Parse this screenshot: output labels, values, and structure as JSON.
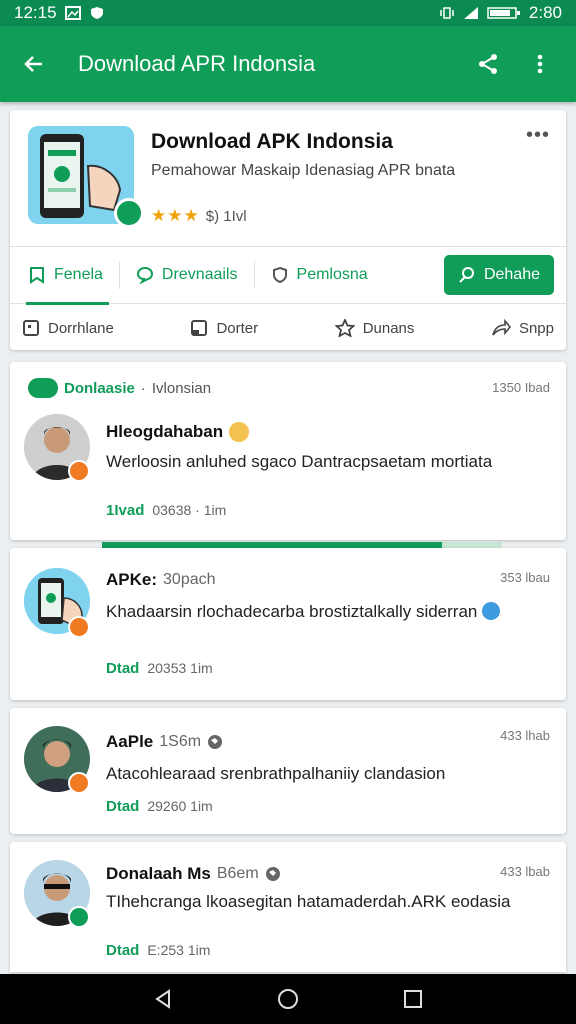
{
  "status_bar": {
    "time": "12:15",
    "right_text": "2:80"
  },
  "app_bar": {
    "title": "Download APR Indonsia"
  },
  "app_card": {
    "name": "Download APK Indonsia",
    "description": "Pemahowar Maskaip Idenasiag APR bnata",
    "rating_text": "$) 1Ivl",
    "stars": 3
  },
  "tabs": [
    {
      "label": "Fenela",
      "icon": "bookmark-icon"
    },
    {
      "label": "Drevnaails",
      "icon": "chat-icon"
    },
    {
      "label": "Pemlosna",
      "icon": "shield-icon"
    }
  ],
  "primary_button": {
    "label": "Dehahe",
    "icon": "search-icon"
  },
  "actions": [
    {
      "label": "Dorrhlane",
      "icon": "note-icon"
    },
    {
      "label": "Dorter",
      "icon": "phone-icon"
    },
    {
      "label": "Dunans",
      "icon": "star-icon"
    },
    {
      "label": "Snpp",
      "icon": "share-arrow-icon"
    }
  ],
  "feed": {
    "chip_label": "Donlaasie",
    "separator": "·",
    "subtitle": "Ivlonsian",
    "count": "1350 Ibad"
  },
  "progress": {
    "value": 0.85
  },
  "posts": [
    {
      "name": "Hleogdahaban",
      "meta": "",
      "text": "Werloosin anluhed sgaco  Dantracpsaetam mortiata",
      "download_label": "1Ivad",
      "stats": "03638 · 1im",
      "time": "",
      "emoji_color": "#f2c14e"
    },
    {
      "name": "APKe:",
      "meta": "30pach",
      "text": "Khadaarsin rlochadecarba  brostiztalkally siderran",
      "download_label": "Dtad",
      "stats": "20353  1im",
      "time": "353 lbau",
      "emoji_color": "#3f9be0"
    },
    {
      "name": "AaPle",
      "meta": "1S6m",
      "text": "Atacohlearaad srenbrathpalhaniiy clandasion",
      "download_label": "Dtad",
      "stats": "29260  1im",
      "time": "433 lhab"
    },
    {
      "name": "Donalaah Ms",
      "meta": "B6em",
      "text": "TIhehcranga lkoasegitan hatamaderdah.ARK eodasia",
      "download_label": "Dtad",
      "stats": "E:253  1im",
      "time": "433 lbab"
    }
  ],
  "colors": {
    "brand": "#0f9d58",
    "brand_dark": "#0b8a52",
    "orange_badge": "#f07a22"
  }
}
